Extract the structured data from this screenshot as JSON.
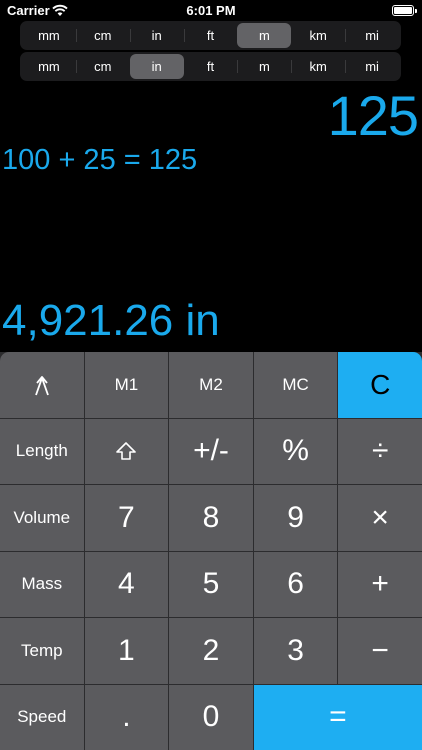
{
  "status_bar": {
    "carrier": "Carrier",
    "time": "6:01 PM"
  },
  "unit_selectors": [
    {
      "options": [
        "mm",
        "cm",
        "in",
        "ft",
        "m",
        "km",
        "mi"
      ],
      "selected": "m"
    },
    {
      "options": [
        "mm",
        "cm",
        "in",
        "ft",
        "m",
        "km",
        "mi"
      ],
      "selected": "in"
    }
  ],
  "display": {
    "result": "125",
    "expression": "100 + 25 = 125",
    "converted": "4,921.26 in"
  },
  "keys": {
    "m1": "M1",
    "m2": "M2",
    "mc": "MC",
    "clear": "C",
    "length": "Length",
    "plus_minus": "+/-",
    "percent": "%",
    "divide": "÷",
    "volume": "Volume",
    "seven": "7",
    "eight": "8",
    "nine": "9",
    "multiply": "×",
    "mass": "Mass",
    "four": "4",
    "five": "5",
    "six": "6",
    "add": "+",
    "temp": "Temp",
    "one": "1",
    "two": "2",
    "three": "3",
    "subtract": "−",
    "speed": "Speed",
    "decimal": ".",
    "zero": "0",
    "equals": "="
  },
  "colors": {
    "accent": "#1aa9ec",
    "key_gray": "#5b5b5e",
    "key_blue": "#1eaef2"
  }
}
